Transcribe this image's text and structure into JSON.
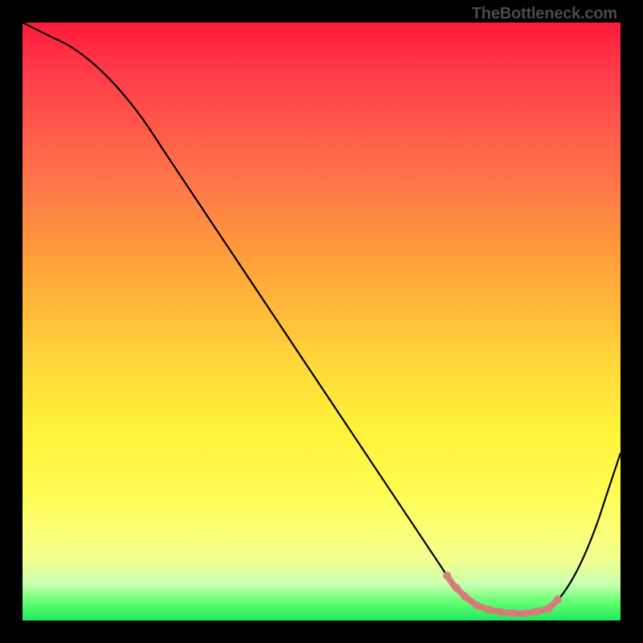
{
  "watermark": "TheBottleneck.com",
  "chart_data": {
    "type": "line",
    "title": "",
    "xlabel": "",
    "ylabel": "",
    "xlim": [
      0,
      100
    ],
    "ylim": [
      0,
      100
    ],
    "grid": false,
    "series": [
      {
        "name": "bottleneck-curve",
        "color": "#000000",
        "x": [
          0,
          4,
          8,
          12,
          16,
          20,
          24,
          28,
          32,
          36,
          40,
          44,
          48,
          52,
          56,
          60,
          64,
          68,
          70,
          72,
          74,
          76,
          78,
          80,
          82,
          84,
          86,
          88,
          90,
          92,
          94,
          96,
          98,
          100
        ],
        "y": [
          100,
          98,
          96,
          93,
          89,
          84,
          78,
          72,
          66,
          60,
          54,
          48,
          42,
          36,
          30,
          24,
          18,
          12,
          9,
          6,
          4,
          2.5,
          1.8,
          1.4,
          1.2,
          1.2,
          1.5,
          2,
          4,
          7,
          11,
          16,
          22,
          28
        ]
      }
    ],
    "marker_region": {
      "name": "optimal-range",
      "color": "#d97b7b",
      "xs": [
        71,
        72.5,
        74,
        76,
        78,
        80,
        82,
        84,
        86,
        88,
        89.5
      ]
    }
  }
}
